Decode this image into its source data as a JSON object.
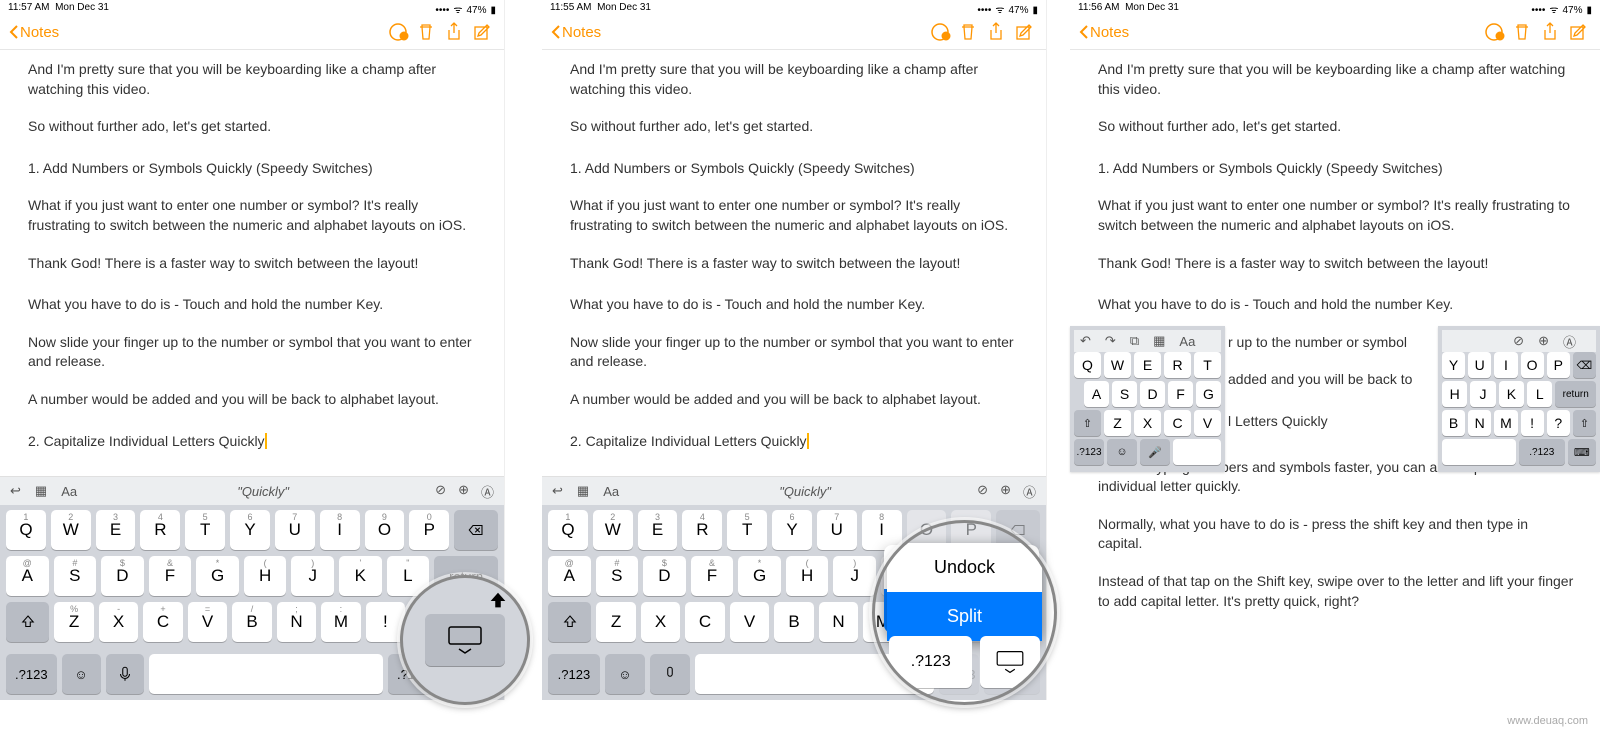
{
  "status": {
    "times": [
      "11:57 AM",
      "11:55 AM",
      "11:56 AM"
    ],
    "date": "Mon Dec 31",
    "battery": "47%"
  },
  "toolbar": {
    "back_label": "Notes"
  },
  "note": {
    "p1": "And I'm pretty sure that you will be keyboarding like a champ after watching this video.",
    "p2": "So without further ado, let's get started.",
    "p3": "1. Add Numbers or Symbols Quickly (Speedy Switches)",
    "p4": "What if you just want to enter one number or symbol? It's really frustrating to switch between the numeric and alphabet layouts on iOS.",
    "p5": "Thank God! There is a faster way to switch between the layout!",
    "p6": "What you have to do is - Touch and hold the number Key.",
    "p7": "Now slide your finger up to the number or symbol that you want to enter and release.",
    "p8": "A number would be added and you will be back to alphabet layout.",
    "p9": "2. Capitalize Individual Letters Quickly",
    "p10": "Just like typing numbers and symbols faster, you can also capitalize individual letter quickly.",
    "p11": "Normally, what you have to do is - press the shift key and then type in capital.",
    "p12": "Instead of that tap on the Shift key, swipe over to the letter and lift your finger to add capital letter. It's pretty quick, right?",
    "p7_short_a": "r up to the number or symbol",
    "p8_short_a": "added and you will be back to",
    "p9_short_a": "l Letters Quickly"
  },
  "keyboard": {
    "suggestion": "\"Quickly\"",
    "row1_upper": [
      "1",
      "2",
      "3",
      "4",
      "5",
      "6",
      "7",
      "8",
      "9",
      "0"
    ],
    "row1": [
      "Q",
      "W",
      "E",
      "R",
      "T",
      "Y",
      "U",
      "I",
      "O",
      "P"
    ],
    "row2_upper": [
      "@",
      "#",
      "$",
      "&",
      "*",
      "(",
      ")",
      "'",
      "\""
    ],
    "row2": [
      "A",
      "S",
      "D",
      "F",
      "G",
      "H",
      "J",
      "K",
      "L"
    ],
    "row3_upper": [
      "%",
      "-",
      "+",
      "=",
      "/",
      ";",
      ":"
    ],
    "row3": [
      "Z",
      "X",
      "C",
      "V",
      "B",
      "N",
      "M"
    ],
    "punct1": "!",
    "punct2": "?",
    "return_label": "return",
    "numkey": ".?123",
    "popover_undock": "Undock",
    "popover_split": "Split"
  },
  "split": {
    "left_row1": [
      "Q",
      "W",
      "E",
      "R",
      "T"
    ],
    "left_row2": [
      "A",
      "S",
      "D",
      "F",
      "G"
    ],
    "left_row3": [
      "Z",
      "X",
      "C",
      "V"
    ],
    "right_row1": [
      "Y",
      "U",
      "I",
      "O",
      "P"
    ],
    "right_row2": [
      "H",
      "J",
      "K",
      "L"
    ],
    "right_row3": [
      "B",
      "N",
      "M",
      "!",
      "?"
    ],
    "return_label": "return",
    "numkey": ".?123",
    "aa": "Aa"
  },
  "watermark": "www.deuaq.com"
}
